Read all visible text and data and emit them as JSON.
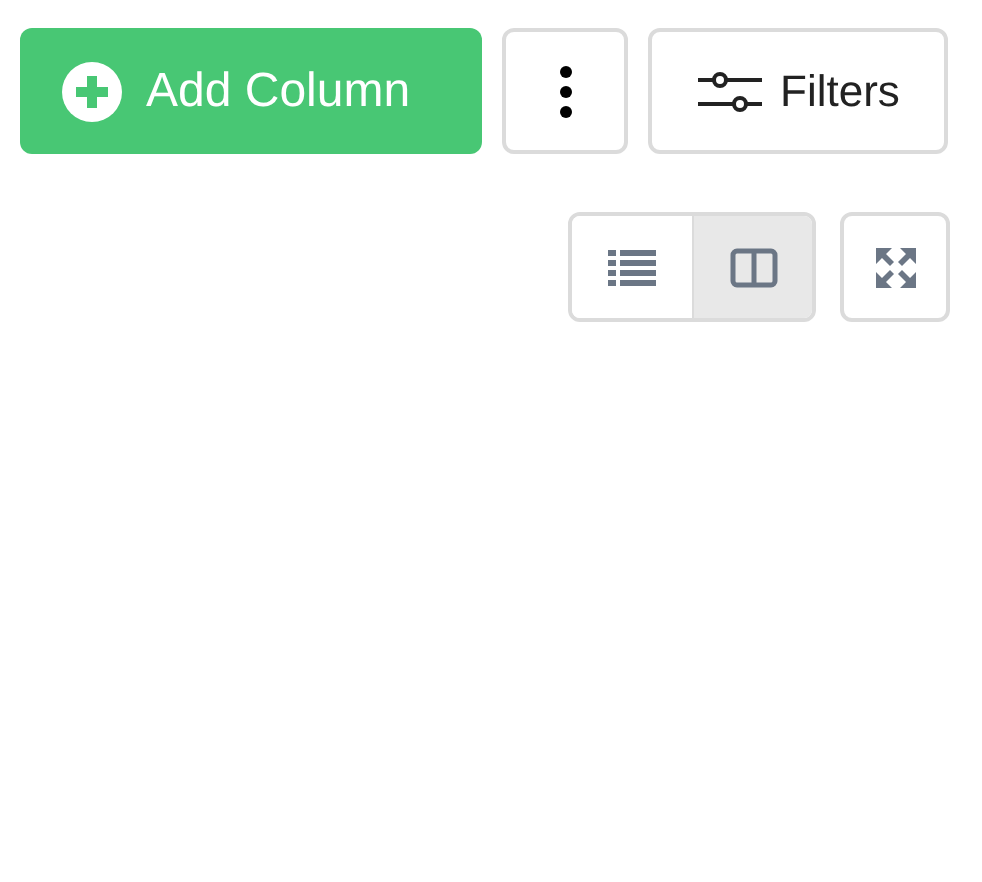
{
  "toolbar": {
    "add_button": {
      "label": "Add Column"
    },
    "filters_button": {
      "label": "Filters"
    }
  },
  "view_toggle": [
    {
      "kind": "list",
      "selected": false
    },
    {
      "kind": "split",
      "selected": true
    }
  ]
}
